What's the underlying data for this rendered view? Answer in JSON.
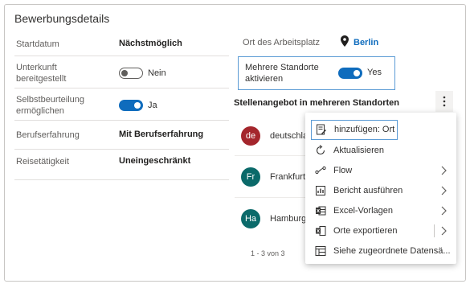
{
  "section": {
    "title": "Bewerbungsdetails"
  },
  "left_fields": {
    "startdatum": {
      "label": "Startdatum",
      "value": "Nächstmöglich"
    },
    "unterkunft": {
      "label": "Unterkunft bereitgestellt",
      "toggle_text": "Nein"
    },
    "selbstbeurteilung": {
      "label": "Selbstbeurteilung ermöglichen",
      "toggle_text": "Ja"
    },
    "berufserfahrung": {
      "label": "Berufserfahrung",
      "value": "Mit Berufserfahrung"
    },
    "reisetaetigkeit": {
      "label": "Reisetätigkeit",
      "value": "Uneingeschränkt"
    }
  },
  "right_fields": {
    "ort": {
      "label": "Ort des Arbeitsplatz",
      "value": "Berlin"
    },
    "mehrere": {
      "label": "Mehrere Standorte aktivieren",
      "toggle_text": "Yes"
    }
  },
  "subgrid": {
    "title": "Stellenangebot in mehreren Standorten",
    "rows": [
      {
        "initials": "de",
        "name": "deutschland",
        "color": "#a4262c"
      },
      {
        "initials": "Fr",
        "name": "Frankfurt",
        "color": "#0b6a6a"
      },
      {
        "initials": "Ha",
        "name": "Hamburg",
        "color": "#0b6a6a"
      }
    ],
    "pager": "1 - 3 von 3"
  },
  "menu": {
    "items": [
      {
        "label": "hinzufügen: Ort",
        "icon": "add-record-icon"
      },
      {
        "label": "Aktualisieren",
        "icon": "refresh-icon"
      },
      {
        "label": "Flow",
        "icon": "flow-icon"
      },
      {
        "label": "Bericht ausführen",
        "icon": "report-icon"
      },
      {
        "label": "Excel-Vorlagen",
        "icon": "excel-icon"
      },
      {
        "label": "Orte exportieren",
        "icon": "export-excel-icon"
      },
      {
        "label": "Siehe zugeordnete Datensä...",
        "icon": "related-records-icon"
      }
    ]
  },
  "colors": {
    "accent": "#0f6cbd",
    "toggle_on": "#0f6cbd",
    "focus_border": "#5b9bd5"
  }
}
